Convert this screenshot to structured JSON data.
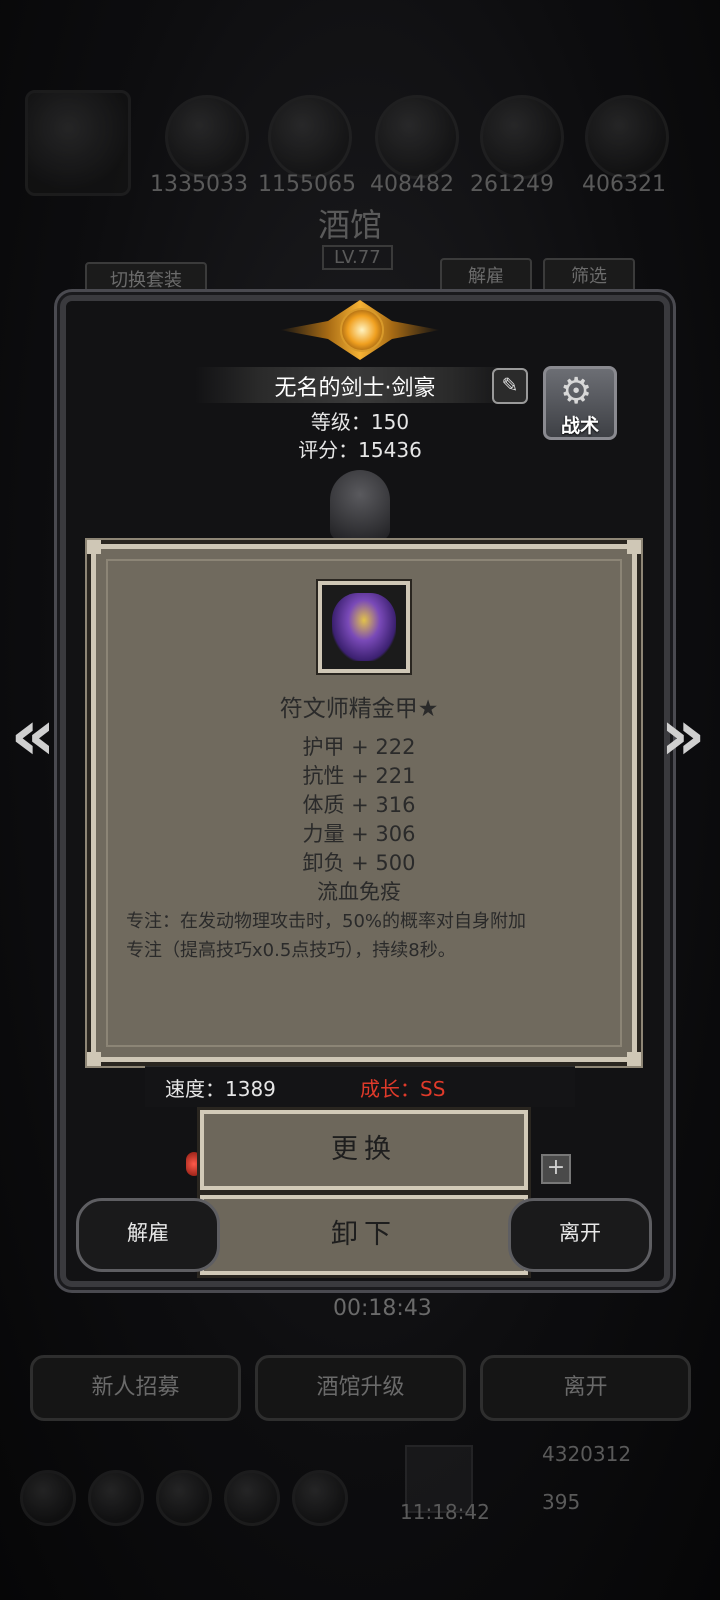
{
  "background": {
    "currencies": [
      "1335033",
      "1155065",
      "408482",
      "261249",
      "406321"
    ],
    "tavern_title": "酒馆",
    "tavern_level": "LV.77",
    "switch_set_label": "切换套装",
    "dismiss_label": "解雇",
    "filter_label": "筛选",
    "timer": "00:18:43",
    "recruit_label": "新人招募",
    "upgrade_label": "酒馆升级",
    "leave_label": "离开",
    "gold_amount": "4320312",
    "clock_time": "11:18:42",
    "gem_amount": "395"
  },
  "hero": {
    "name": "无名的剑士·剑豪",
    "level_text": "等级：150",
    "score_text": "评分：15436",
    "tactic_label": "战术",
    "edit_icon": "pencil-icon",
    "gear_icon": "gear-icon"
  },
  "item": {
    "name": "符文师精金甲★",
    "icon": "armor-icon",
    "stats": [
      "护甲 + 222",
      "抗性 + 221",
      "体质 + 316",
      "力量 + 306",
      "卸负 + 500",
      "流血免疫"
    ],
    "description_lines": [
      "专注：在发动物理攻击时，50%的概率对自身附加",
      "专注（提高技巧x0.5点技巧），持续8秒。"
    ]
  },
  "info": {
    "speed_text": "速度：1389",
    "growth_text": "成长：SS",
    "growth_color": "#e03a2a"
  },
  "actions": {
    "replace_label": "更换",
    "unequip_label": "卸下",
    "dismiss_label": "解雇",
    "leave_label": "离开",
    "prev_arrow": "«",
    "next_arrow": "»",
    "plus_label": "+"
  }
}
